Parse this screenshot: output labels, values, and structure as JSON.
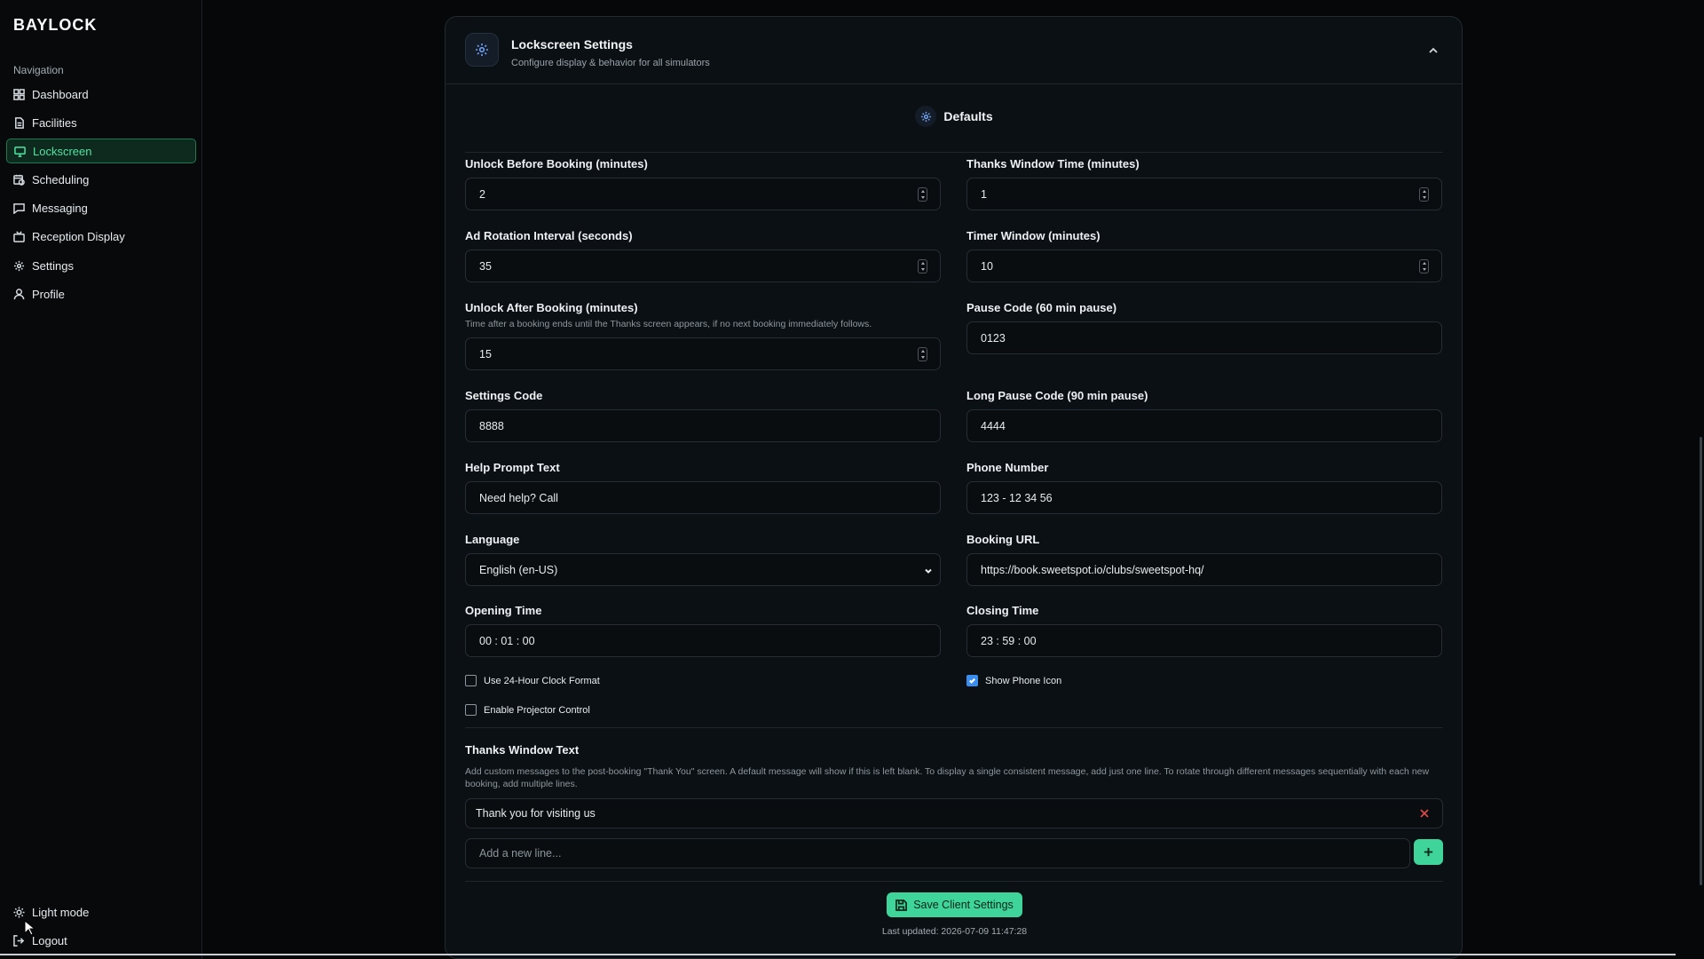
{
  "brand": "BAYLOCK",
  "sidebar": {
    "heading": "Navigation",
    "items": [
      {
        "label": "Dashboard",
        "icon": "dashboard-icon"
      },
      {
        "label": "Facilities",
        "icon": "document-icon"
      },
      {
        "label": "Lockscreen",
        "icon": "monitor-icon",
        "active": true
      },
      {
        "label": "Scheduling",
        "icon": "calendar-clock-icon"
      },
      {
        "label": "Messaging",
        "icon": "message-icon"
      },
      {
        "label": "Reception Display",
        "icon": "tv-icon"
      },
      {
        "label": "Settings",
        "icon": "gear-icon"
      },
      {
        "label": "Profile",
        "icon": "user-icon"
      }
    ],
    "light_mode": "Light mode",
    "logout": "Logout"
  },
  "card": {
    "title": "Lockscreen Settings",
    "subtitle": "Configure display & behavior for all simulators",
    "section": "Defaults"
  },
  "fields": {
    "unlock_before": {
      "label": "Unlock Before Booking (minutes)",
      "value": "2"
    },
    "thanks_window_time": {
      "label": "Thanks Window Time (minutes)",
      "value": "1"
    },
    "ad_rotation": {
      "label": "Ad Rotation Interval (seconds)",
      "value": "35"
    },
    "timer_window": {
      "label": "Timer Window (minutes)",
      "value": "10"
    },
    "unlock_after": {
      "label": "Unlock After Booking (minutes)",
      "help": "Time after a booking ends until the Thanks screen appears, if no next booking immediately follows.",
      "value": "15"
    },
    "pause_code": {
      "label": "Pause Code (60 min pause)",
      "value": "0123"
    },
    "settings_code": {
      "label": "Settings Code",
      "value": "8888"
    },
    "long_pause_code": {
      "label": "Long Pause Code (90 min pause)",
      "value": "4444"
    },
    "help_prompt": {
      "label": "Help Prompt Text",
      "value": "Need help? Call"
    },
    "phone_number": {
      "label": "Phone Number",
      "value": "123 - 12 34 56"
    },
    "language": {
      "label": "Language",
      "value": "English (en-US)"
    },
    "booking_url": {
      "label": "Booking URL",
      "value": "https://book.sweetspot.io/clubs/sweetspot-hq/"
    },
    "opening_time": {
      "label": "Opening Time",
      "value": "00 : 01 : 00"
    },
    "closing_time": {
      "label": "Closing Time",
      "value": "23 : 59 : 00"
    }
  },
  "checkboxes": {
    "clock_24h": {
      "label": "Use 24-Hour Clock Format",
      "checked": false
    },
    "show_phone_icon": {
      "label": "Show Phone Icon",
      "checked": true
    },
    "projector": {
      "label": "Enable Projector Control",
      "checked": false
    }
  },
  "thanks_window": {
    "title": "Thanks Window Text",
    "help": "Add custom messages to the post-booking \"Thank You\" screen. A default message will show if this is left blank. To display a single consistent message, add just one line. To rotate through different messages sequentially with each new booking, add multiple lines.",
    "lines": [
      "Thank you for visiting us"
    ],
    "new_placeholder": "Add a new line..."
  },
  "save_label": "Save Client Settings",
  "last_updated": "Last updated: 2026-07-09 11:47:28",
  "colors": {
    "accent": "#3fd59a",
    "active_nav": "#4ee3a1",
    "background": "#050709",
    "card": "#0b1014",
    "checkbox_checked": "#3a8ef0",
    "remove": "#d94848"
  }
}
